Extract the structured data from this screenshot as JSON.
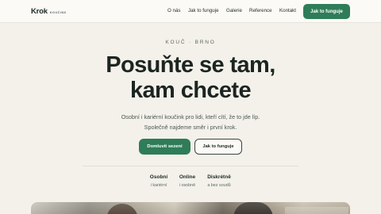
{
  "header": {
    "logo": "Krok",
    "logo_sub": "KOUČINK",
    "nav": [
      "O nás",
      "Jak to funguje",
      "Galerie",
      "Reference",
      "Kontakt"
    ],
    "cta": "Jak to funguje"
  },
  "hero": {
    "eyebrow": "KOUČ · BRNO",
    "title_line1": "Posuňte se tam,",
    "title_line2": "kam chcete",
    "subtitle_line1": "Osobní i kariérní koučink pro lidi, kteří cítí, že to jde líp.",
    "subtitle_line2": "Společně najdeme směr i první krok.",
    "primary_button": "Domluvit sezení",
    "secondary_button": "Jak to funguje"
  },
  "features": [
    {
      "title": "Osobní",
      "sub": "i kariérní"
    },
    {
      "title": "Online",
      "sub": "i osobně"
    },
    {
      "title": "Diskrétně",
      "sub": "a bez soudů"
    }
  ],
  "colors": {
    "accent": "#2e7d58",
    "background": "#f3f1ea",
    "text": "#1f2a25"
  }
}
